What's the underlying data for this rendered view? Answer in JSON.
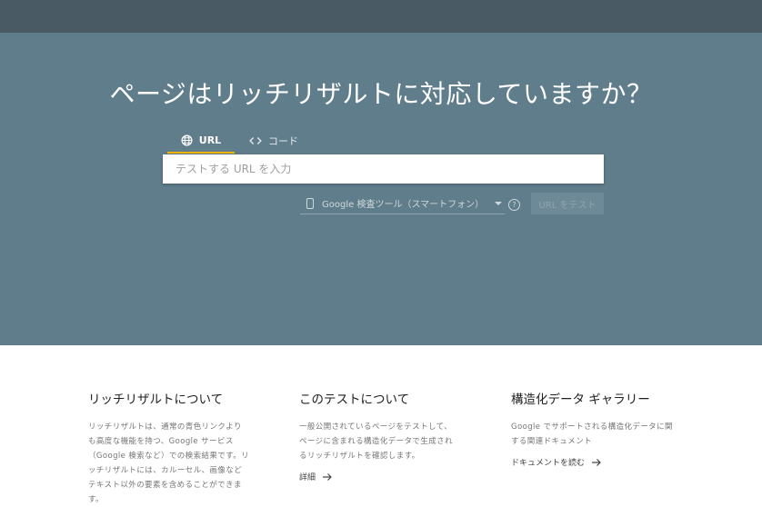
{
  "hero": {
    "title": "ページはリッチリザルトに対応していますか？",
    "tabs": [
      {
        "label": "URL",
        "icon": "globe-icon",
        "active": true
      },
      {
        "label": "コード",
        "icon": "code-icon",
        "active": false
      }
    ],
    "url_input_placeholder": "テストする URL を入力",
    "user_agent_select": "Google 検査ツール（スマートフォン）",
    "help_symbol": "?",
    "test_button": "URL をテスト"
  },
  "info": [
    {
      "title": "リッチリザルトについて",
      "lines": [
        "リッチリザルトは、通常の青色リンクより",
        "も高度な機能を持つ、Google サービス",
        "（Google 検索など）での検索結果です。リ",
        "ッチリザルトには、カルーセル、画像など",
        "テキスト以外の要素を含めることができま",
        "す。"
      ],
      "link": ""
    },
    {
      "title": "このテストについて",
      "lines": [
        "一般公開されているページをテストして、",
        "ページに含まれる構造化データで生成され",
        "るリッチリザルトを確認します。"
      ],
      "link": "詳細"
    },
    {
      "title": "構造化データ ギャラリー",
      "lines": [
        "Google でサポートされる構造化データに関",
        "する関連ドキュメント"
      ],
      "link": "ドキュメントを読む"
    }
  ],
  "colors": {
    "topbar": "#4a5a64",
    "hero": "#607d8b",
    "tab_underline": "#f4b400"
  }
}
